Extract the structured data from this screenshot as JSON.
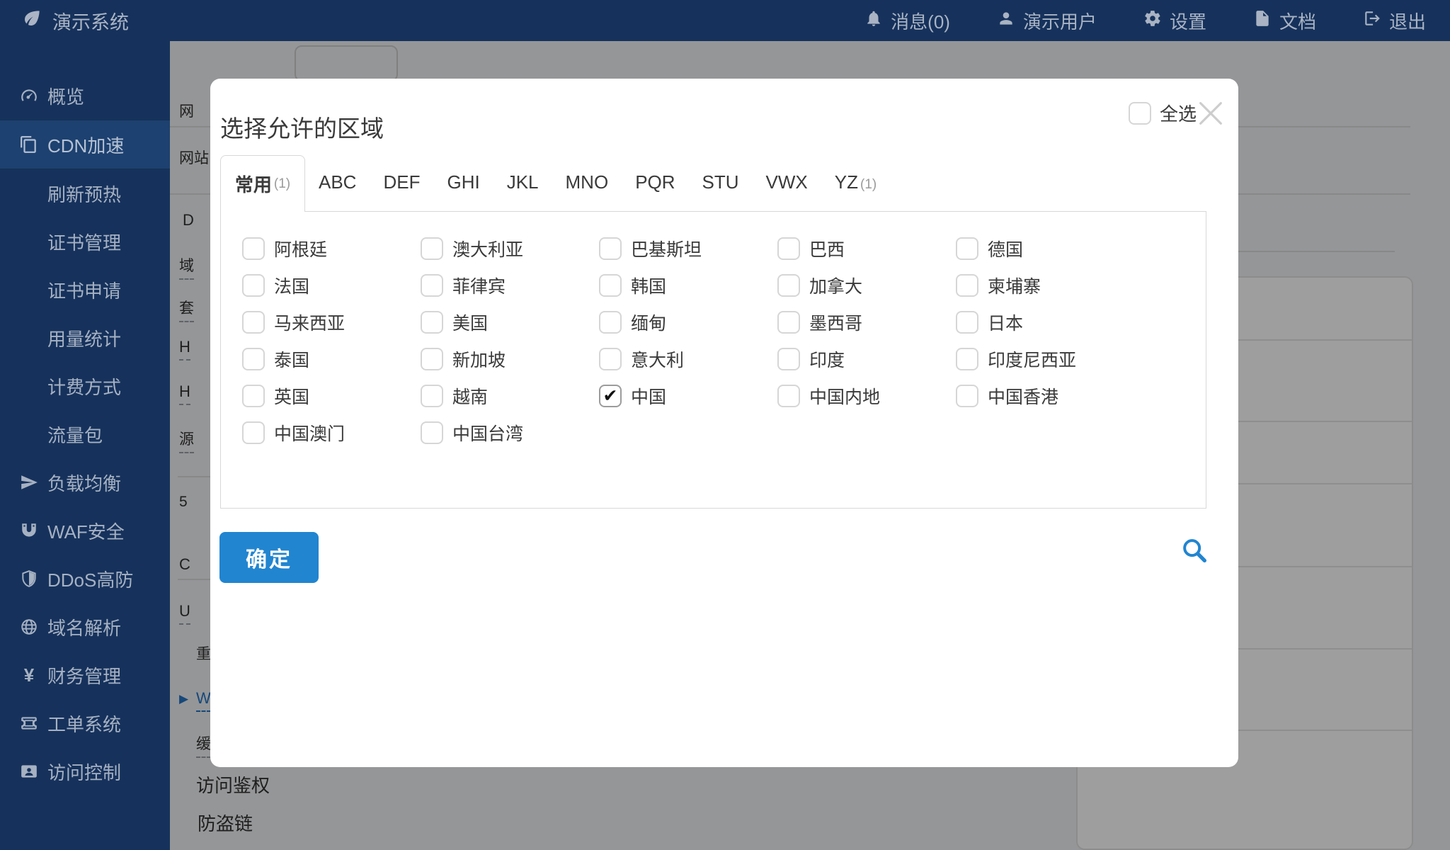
{
  "colors": {
    "navy": "#16325c",
    "navy_active": "#1d4170",
    "accent_blue": "#2185d0",
    "dim_overlay": "rgba(0,0,0,0.38)"
  },
  "navbar": {
    "brand": {
      "icon": "leaf-icon",
      "label": "演示系统"
    },
    "items": [
      {
        "icon": "bell-icon",
        "label": "消息(0)",
        "name": "messages"
      },
      {
        "icon": "user-icon",
        "label": "演示用户",
        "name": "current-user"
      },
      {
        "icon": "gear-icon",
        "label": "设置",
        "name": "settings"
      },
      {
        "icon": "file-icon",
        "label": "文档",
        "name": "docs"
      },
      {
        "icon": "logout-icon",
        "label": "退出",
        "name": "logout"
      }
    ]
  },
  "sidebar": {
    "items": [
      {
        "icon": "dashboard-icon",
        "label": "概览",
        "name": "overview"
      },
      {
        "icon": "clone-icon",
        "label": "CDN加速",
        "name": "cdn",
        "active": true
      },
      {
        "label": "刷新预热",
        "name": "refresh-preheat",
        "sub": true
      },
      {
        "label": "证书管理",
        "name": "cert-manage",
        "sub": true
      },
      {
        "label": "证书申请",
        "name": "cert-apply",
        "sub": true
      },
      {
        "label": "用量统计",
        "name": "usage-stats",
        "sub": true
      },
      {
        "label": "计费方式",
        "name": "billing",
        "sub": true
      },
      {
        "label": "流量包",
        "name": "traffic-pack",
        "sub": true
      },
      {
        "icon": "send-icon",
        "label": "负载均衡",
        "name": "load-balance"
      },
      {
        "icon": "magnet-icon",
        "label": "WAF安全",
        "name": "waf"
      },
      {
        "icon": "shield-icon",
        "label": "DDoS高防",
        "name": "ddos"
      },
      {
        "icon": "globe-icon",
        "label": "域名解析",
        "name": "dns"
      },
      {
        "icon": "yen-icon",
        "label": "财务管理",
        "name": "finance"
      },
      {
        "icon": "ticket-icon",
        "label": "工单系统",
        "name": "tickets"
      },
      {
        "icon": "idcard-icon",
        "label": "访问控制",
        "name": "access-control"
      }
    ]
  },
  "underlay": {
    "fragments": [
      {
        "text": "网"
      },
      {
        "text": "网站"
      },
      {
        "text": "D"
      },
      {
        "text": "域",
        "dashed": true
      },
      {
        "text": "套",
        "dashed": true
      },
      {
        "text": "H",
        "dashed": true
      },
      {
        "text": "H",
        "dashed": true
      },
      {
        "text": "源",
        "dashed": true
      },
      {
        "text": "5"
      },
      {
        "text": "C"
      },
      {
        "text": "U",
        "dashed": true
      },
      {
        "text": "重"
      },
      {
        "text": "W",
        "link": true
      },
      {
        "text": "缓",
        "dashed": true
      },
      {
        "text": "访问鉴权"
      },
      {
        "text": "防盗链"
      }
    ]
  },
  "modal": {
    "title": "选择允许的区域",
    "close_icon": "close-icon",
    "tabs": [
      {
        "label": "常用",
        "count": "(1)",
        "active": true
      },
      {
        "label": "ABC"
      },
      {
        "label": "DEF"
      },
      {
        "label": "GHI"
      },
      {
        "label": "JKL"
      },
      {
        "label": "MNO"
      },
      {
        "label": "PQR"
      },
      {
        "label": "STU"
      },
      {
        "label": "VWX"
      },
      {
        "label": "YZ",
        "count": "(1)"
      }
    ],
    "select_all_label": "全选",
    "select_all_checked": false,
    "regions": [
      {
        "label": "阿根廷"
      },
      {
        "label": "澳大利亚"
      },
      {
        "label": "巴基斯坦"
      },
      {
        "label": "巴西"
      },
      {
        "label": "德国"
      },
      {
        "label": "法国"
      },
      {
        "label": "菲律宾"
      },
      {
        "label": "韩国"
      },
      {
        "label": "加拿大"
      },
      {
        "label": "柬埔寨"
      },
      {
        "label": "马来西亚"
      },
      {
        "label": "美国"
      },
      {
        "label": "缅甸"
      },
      {
        "label": "墨西哥"
      },
      {
        "label": "日本"
      },
      {
        "label": "泰国"
      },
      {
        "label": "新加坡"
      },
      {
        "label": "意大利"
      },
      {
        "label": "印度"
      },
      {
        "label": "印度尼西亚"
      },
      {
        "label": "英国"
      },
      {
        "label": "越南"
      },
      {
        "label": "中国",
        "checked": true
      },
      {
        "label": "中国内地"
      },
      {
        "label": "中国香港"
      },
      {
        "label": "中国澳门"
      },
      {
        "label": "中国台湾"
      }
    ],
    "confirm_label": "确定",
    "check_glyph": "✔",
    "caret_glyph": "▶"
  }
}
